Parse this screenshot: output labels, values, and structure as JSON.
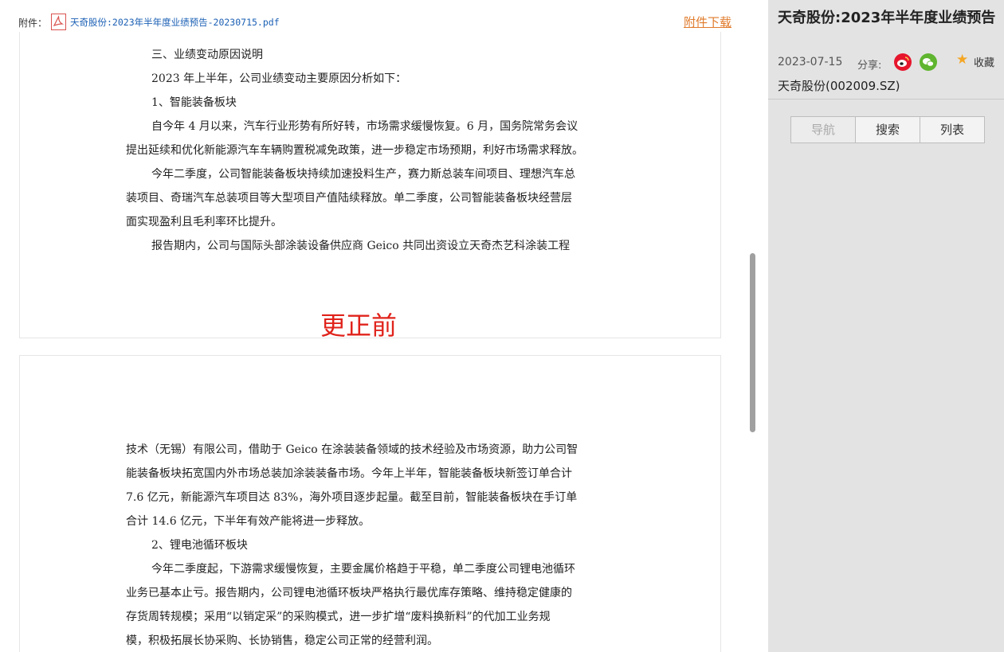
{
  "attachment": {
    "label": "附件：",
    "file_name": "天奇股份:2023年半年度业绩预告-20230715.pdf",
    "download": "附件下载"
  },
  "page1": {
    "lines": [
      "三、业绩变动原因说明",
      "2023 年上半年，公司业绩变动主要原因分析如下：",
      "1、智能装备板块",
      "自今年 4 月以来，汽车行业形势有所好转，市场需求缓慢恢复。6 月，国务院常务会议",
      "提出延续和优化新能源汽车车辆购置税减免政策，进一步稳定市场预期，利好市场需求释放。",
      "今年二季度，公司智能装备板块持续加速投料生产，赛力斯总装车间项目、理想汽车总",
      "装项目、奇瑞汽车总装项目等大型项目产值陆续释放。单二季度，公司智能装备板块经营层",
      "面实现盈利且毛利率环比提升。",
      "报告期内，公司与国际头部涂装设备供应商 Geico 共同出资设立天奇杰艺科涂装工程"
    ],
    "correction_label": "更正前"
  },
  "page2": {
    "lines": [
      "技术（无锡）有限公司，借助于 Geico 在涂装装备领域的技术经验及市场资源，助力公司智",
      "能装备板块拓宽国内外市场总装加涂装装备市场。今年上半年，智能装备板块新签订单合计",
      "7.6 亿元，新能源汽车项目达 83%，海外项目逐步起量。截至目前，智能装备板块在手订单",
      "合计 14.6 亿元，下半年有效产能将进一步释放。",
      "2、锂电池循环板块",
      "今年二季度起，下游需求缓慢恢复，主要金属价格趋于平稳，单二季度公司锂电池循环",
      "业务已基本止亏。报告期内，公司锂电池循环板块严格执行最优库存策略、维持稳定健康的",
      "存货周转规模；采用“以销定采”的采购模式，进一步扩增“废料换新料”的代加工业务规",
      "模，积极拓展长协采购、长协销售，稳定公司正常的经营利润。"
    ]
  },
  "sidebar": {
    "title": "天奇股份:2023年半年度业绩预告",
    "date": "2023-07-15",
    "share_label": "分享:",
    "favorite_label": "收藏",
    "stock": "天奇股份(002009.SZ)",
    "tabs": [
      "导航",
      "搜索",
      "列表"
    ]
  },
  "colors": {
    "accent_orange": "#e07b2c",
    "link_blue": "#1a5fb4",
    "correction_red": "#e0231b",
    "weibo_red": "#e6162d",
    "wechat_green": "#5fb52f",
    "sidebar_bg": "#e3e3e3"
  },
  "icons": [
    "pdf-icon",
    "weibo-icon",
    "wechat-icon",
    "star-icon"
  ]
}
